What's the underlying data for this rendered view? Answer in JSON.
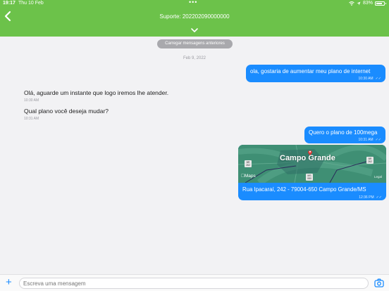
{
  "status_bar": {
    "time": "19:17",
    "date": "Thu 10 Feb",
    "dots": "•••",
    "battery": "83%",
    "battery_level": 0.83
  },
  "header": {
    "title": "Suporte: 202202090000000"
  },
  "chat": {
    "load_previous": "Carregar mensagens anteriores",
    "date_separator": "Feb 9, 2022",
    "messages": [
      {
        "direction": "out",
        "text": "ola, gostaria de aumentar meu plano de internet",
        "time": "10:30 AM",
        "ticks": "✓✓"
      },
      {
        "direction": "in",
        "text": "Olá, aguarde um instante que logo iremos lhe atender.",
        "time": "10:30 AM"
      },
      {
        "direction": "in",
        "text": "Qual plano você deseja mudar?",
        "time": "10:31 AM"
      },
      {
        "direction": "out",
        "text": "Quero o plano de 100mega",
        "time": "10:31 AM",
        "ticks": "✓✓"
      }
    ],
    "location": {
      "city": "Campo Grande",
      "maps_label": "Maps",
      "legal": "Legal",
      "shields": [
        "BR 262",
        "BR 262",
        "MS 080"
      ],
      "address": "Rua Ipacaraí, 242 - 79004-650 Campo Grande/MS",
      "time": "12:36 PM",
      "ticks": "✓✓"
    }
  },
  "composer": {
    "placeholder": "Escreva uma mensagem"
  },
  "colors": {
    "header": "#6cc24a",
    "outgoing_bubble": "#1a8cff",
    "background": "#f2f2f4",
    "map": "#3f8f74"
  }
}
